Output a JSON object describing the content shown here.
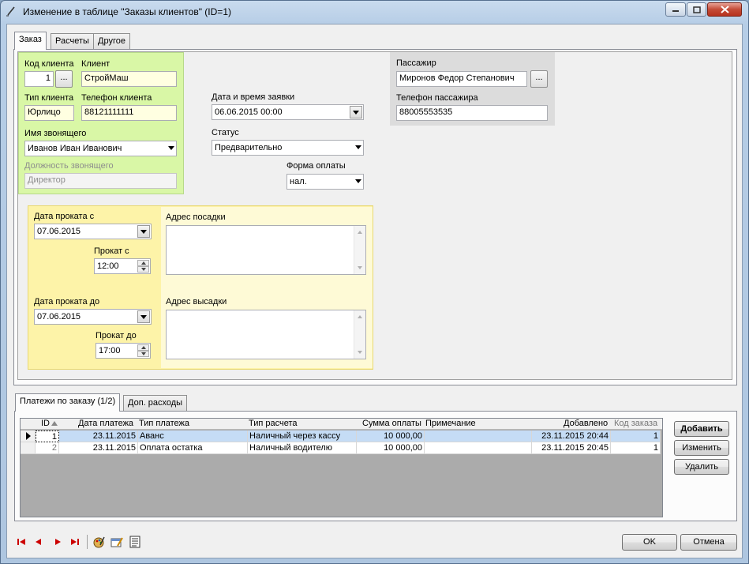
{
  "window": {
    "title": "Изменение в таблице \"Заказы клиентов\" (ID=1)"
  },
  "tabs": [
    {
      "label": "Заказ"
    },
    {
      "label": "Расчеты"
    },
    {
      "label": "Другое"
    }
  ],
  "client_block": {
    "client_code_label": "Код клиента",
    "client_code_value": "1",
    "client_label": "Клиент",
    "client_value": "СтройМаш",
    "client_type_label": "Тип клиента",
    "client_type_value": "Юрлицо",
    "client_phone_label": "Телефон клиента",
    "client_phone_value": "88121111111",
    "caller_name_label": "Имя звонящего",
    "caller_name_value": "Иванов Иван Иванович",
    "caller_position_label": "Должность звонящего",
    "caller_position_value": "Директор",
    "ellipsis": "..."
  },
  "order_block": {
    "request_date_label": "Дата и время заявки",
    "request_date_value": "06.06.2015 00:00",
    "status_label": "Статус",
    "status_value": "Предварительно",
    "payment_form_label": "Форма оплаты",
    "payment_form_value": "нал."
  },
  "passenger_block": {
    "passenger_label": "Пассажир",
    "passenger_value": "Миронов Федор Степанович",
    "passenger_phone_label": "Телефон пассажира",
    "passenger_phone_value": "88005553535",
    "ellipsis": "..."
  },
  "rental_block": {
    "date_from_label": "Дата проката с",
    "date_from_value": "07.06.2015",
    "time_from_label": "Прокат с",
    "time_from_value": "12:00",
    "date_to_label": "Дата проката до",
    "date_to_value": "07.06.2015",
    "time_to_label": "Прокат до",
    "time_to_value": "17:00",
    "pickup_address_label": "Адрес посадки",
    "dropoff_address_label": "Адрес высадки"
  },
  "bottom_tabs": [
    {
      "label": "Платежи по заказу (1/2)"
    },
    {
      "label": "Доп. расходы"
    }
  ],
  "payments_grid": {
    "columns": [
      "ID",
      "Дата платежа",
      "Тип платежа",
      "Тип расчета",
      "Сумма оплаты",
      "Примечание",
      "Добавлено",
      "Код заказа"
    ],
    "rows": [
      [
        "1",
        "23.11.2015",
        "Аванс",
        "Наличный через кассу",
        "10 000,00",
        "",
        "23.11.2015 20:44",
        "1"
      ],
      [
        "2",
        "23.11.2015",
        "Оплата остатка",
        "Наличный водителю",
        "10 000,00",
        "",
        "23.11.2015 20:45",
        "1"
      ]
    ]
  },
  "grid_buttons": {
    "add": "Добавить",
    "edit": "Изменить",
    "delete": "Удалить"
  },
  "dialog_buttons": {
    "ok": "OK",
    "cancel": "Отмена"
  },
  "colors": {
    "client_panel": "#d9f7a6",
    "rental_panel": "#fdf3a8",
    "passenger_panel": "#dcdcdc",
    "selected_row": "#c5dcf5"
  }
}
